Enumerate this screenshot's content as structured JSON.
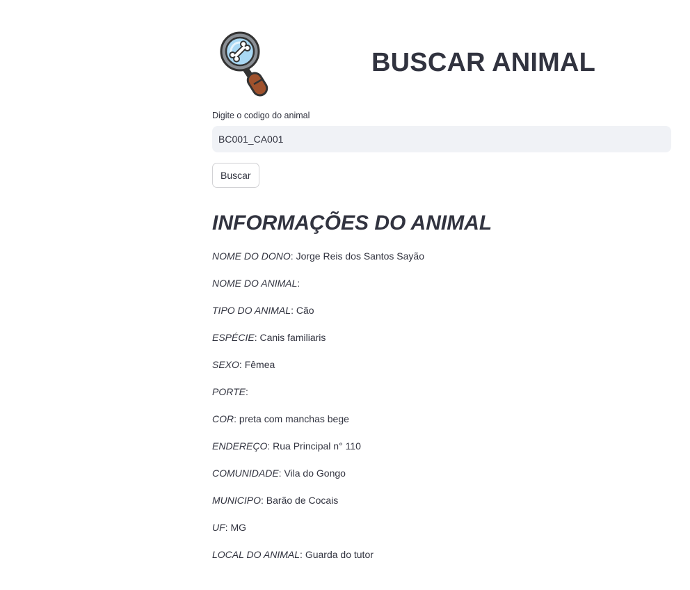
{
  "header": {
    "title": "BUSCAR ANIMAL",
    "logo_icon": "magnifying-glass-bone-icon"
  },
  "search": {
    "label": "Digite o codigo do animal",
    "value": "BC001_CA001",
    "button_label": "Buscar"
  },
  "info": {
    "title": "INFORMAÇÕES DO ANIMAL",
    "fields": [
      {
        "key": "NOME DO DONO",
        "value": "Jorge Reis dos Santos Sayão"
      },
      {
        "key": "NOME DO ANIMAL",
        "value": ""
      },
      {
        "key": "TIPO DO ANIMAL",
        "value": "Cão"
      },
      {
        "key": "ESPÉCIE",
        "value": "Canis familiaris"
      },
      {
        "key": "SEXO",
        "value": "Fêmea"
      },
      {
        "key": "PORTE",
        "value": ""
      },
      {
        "key": "COR",
        "value": "preta com manchas bege"
      },
      {
        "key": "ENDEREÇO",
        "value": "Rua Principal n° 110"
      },
      {
        "key": "COMUNIDADE",
        "value": "Vila do Gongo"
      },
      {
        "key": "MUNICIPO",
        "value": "Barão de Cocais"
      },
      {
        "key": "UF",
        "value": "MG"
      },
      {
        "key": "LOCAL DO ANIMAL",
        "value": "Guarda do tutor"
      }
    ]
  },
  "colors": {
    "text": "#31333f",
    "input_bg": "#f0f2f6",
    "lens_glass": "#a9d8f4",
    "handle": "#a0522d"
  }
}
